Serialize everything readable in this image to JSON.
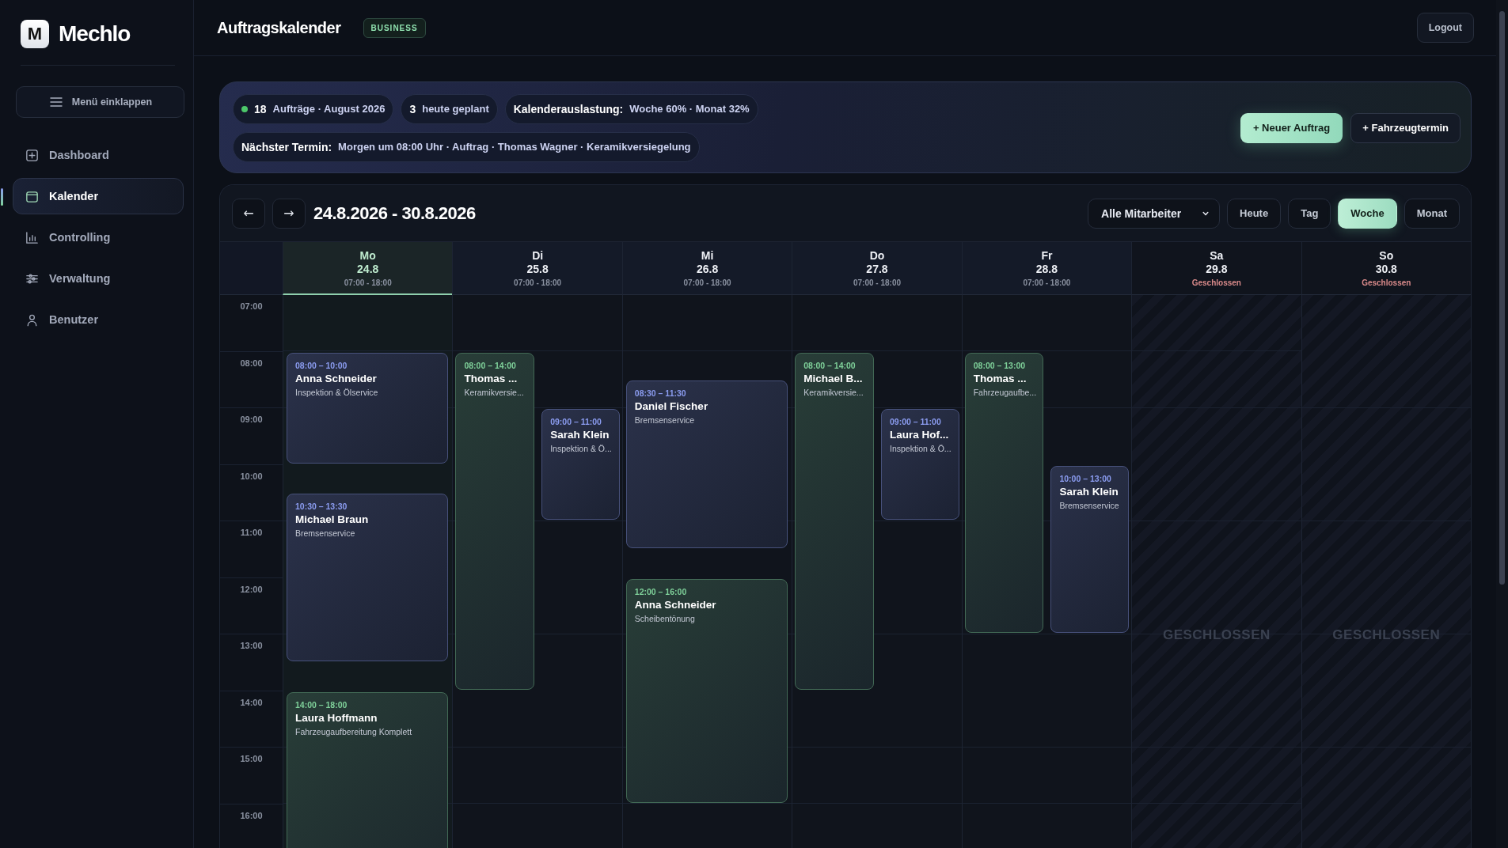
{
  "brand": {
    "logo_letter": "M",
    "name": "Mechlo"
  },
  "sidebar": {
    "collapse_button": "Menü einklappen",
    "items": [
      {
        "label": "Dashboard",
        "selected": false
      },
      {
        "label": "Kalender",
        "selected": true
      },
      {
        "label": "Controlling",
        "selected": false
      },
      {
        "label": "Verwaltung",
        "selected": false
      },
      {
        "label": "Benutzer",
        "selected": false
      }
    ]
  },
  "header": {
    "title": "Auftragskalender",
    "badge": "BUSINESS",
    "logout": "Logout"
  },
  "summary": {
    "rows": [
      [
        {
          "strong": "18",
          "text": "Aufträge · August 2026",
          "color": "#4cc76a"
        },
        {
          "strong": "3",
          "text": "heute geplant"
        },
        {
          "strong": "Kalenderauslastung:",
          "text": "Woche 60% · Monat 32%"
        }
      ],
      [
        {
          "strong": "Nächster Termin:",
          "text": "Morgen um 08:00 Uhr · Auftrag · Thomas Wagner · Keramikversiegelung"
        }
      ]
    ],
    "actions": [
      {
        "label": "+ Neuer Auftrag",
        "kind": "primary"
      },
      {
        "label": "+ Fahrzeugtermin",
        "kind": "secondary"
      }
    ]
  },
  "calendar": {
    "prev": "←",
    "next": "→",
    "range": "24.8.2026 - 30.8.2026",
    "employee_filter": "Alle Mitarbeiter",
    "views": [
      {
        "label": "Heute",
        "selected": false
      },
      {
        "label": "Tag",
        "selected": false
      },
      {
        "label": "Woche",
        "selected": true
      },
      {
        "label": "Monat",
        "selected": false
      }
    ],
    "hours": [
      "07:00",
      "08:00",
      "09:00",
      "10:00",
      "11:00",
      "12:00",
      "13:00",
      "14:00",
      "15:00",
      "16:00"
    ],
    "days": [
      {
        "weekday": "Mo",
        "date": "24.8",
        "hours": "07:00 - 18:00",
        "closed": false,
        "selected": true,
        "events": [
          {
            "time": "08:00 – 10:00",
            "name": "Anna Schneider",
            "service": "Inspektion & Ölservice",
            "color": "#8b9cf0",
            "kind": "full"
          },
          {
            "time": "10:30 – 13:30",
            "name": "Michael Braun",
            "service": "Bremsenservice",
            "color": "#8b9cf0",
            "kind": "full"
          },
          {
            "time": "14:00 – 18:00",
            "name": "Laura Hoffmann",
            "service": "Fahrzeugaufbereitung Komplett",
            "color": "#7fd19a",
            "kind": "full"
          }
        ]
      },
      {
        "weekday": "Di",
        "date": "25.8",
        "hours": "07:00 - 18:00",
        "closed": false,
        "selected": false,
        "events": [
          {
            "time": "08:00 – 14:00",
            "name": "Thomas ...",
            "service": "Keramikversie...",
            "color": "#7fd19a",
            "kind": "left"
          },
          {
            "time": "09:00 – 11:00",
            "name": "Sarah Klein",
            "service": "Inspektion & Ö...",
            "color": "#8b9cf0",
            "kind": "right"
          }
        ]
      },
      {
        "weekday": "Mi",
        "date": "26.8",
        "hours": "07:00 - 18:00",
        "closed": false,
        "selected": false,
        "events": [
          {
            "time": "08:30 – 11:30",
            "name": "Daniel Fischer",
            "service": "Bremsenservice",
            "color": "#8b9cf0",
            "kind": "full"
          },
          {
            "time": "12:00 – 16:00",
            "name": "Anna Schneider",
            "service": "Scheibentönung",
            "color": "#7fd19a",
            "kind": "full"
          }
        ]
      },
      {
        "weekday": "Do",
        "date": "27.8",
        "hours": "07:00 - 18:00",
        "closed": false,
        "selected": false,
        "events": [
          {
            "time": "08:00 – 14:00",
            "name": "Michael B...",
            "service": "Keramikversie...",
            "color": "#7fd19a",
            "kind": "left"
          },
          {
            "time": "09:00 – 11:00",
            "name": "Laura Hof...",
            "service": "Inspektion & Ö...",
            "color": "#8b9cf0",
            "kind": "right"
          }
        ]
      },
      {
        "weekday": "Fr",
        "date": "28.8",
        "hours": "07:00 - 18:00",
        "closed": false,
        "selected": false,
        "events": [
          {
            "time": "08:00 – 13:00",
            "name": "Thomas ...",
            "service": "Fahrzeugaufbe...",
            "color": "#7fd19a",
            "kind": "left"
          },
          {
            "time": "10:00 – 13:00",
            "name": "Sarah Klein",
            "service": "Bremsenservice",
            "color": "#8b9cf0",
            "kind": "right"
          }
        ]
      },
      {
        "weekday": "Sa",
        "date": "29.8",
        "hours": "Geschlossen",
        "closed": true,
        "selected": false,
        "closed_label": "GESCHLOSSEN"
      },
      {
        "weekday": "So",
        "date": "30.8",
        "hours": "Geschlossen",
        "closed": true,
        "selected": false,
        "closed_label": "GESCHLOSSEN"
      }
    ]
  }
}
